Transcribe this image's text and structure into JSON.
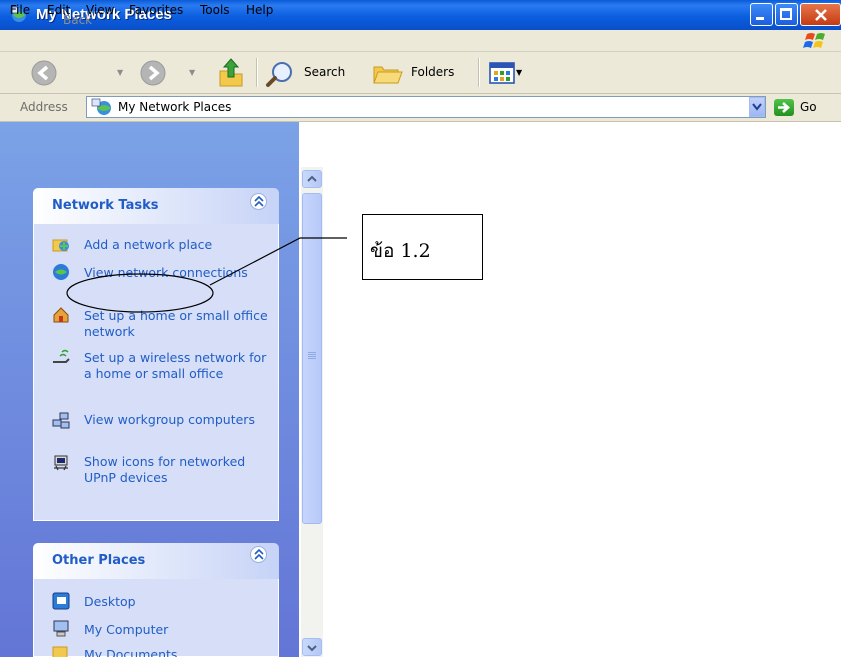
{
  "window": {
    "title": "My Network Places"
  },
  "menu": {
    "items": [
      "File",
      "Edit",
      "View",
      "Favorites",
      "Tools",
      "Help"
    ]
  },
  "toolbar": {
    "back_label": "Back",
    "search_label": "Search",
    "folders_label": "Folders"
  },
  "address": {
    "label": "Address",
    "value": "My Network Places",
    "go_label": "Go"
  },
  "network_tasks": {
    "title": "Network Tasks",
    "items": [
      {
        "label": "Add a network place",
        "icon": "add-network-place-icon"
      },
      {
        "label": "View network connections",
        "icon": "network-connections-icon"
      },
      {
        "label": "Set up a home or small office network",
        "icon": "home-network-icon"
      },
      {
        "label": "Set up a wireless network for a home or small office",
        "icon": "wireless-network-icon"
      },
      {
        "label": "View workgroup computers",
        "icon": "workgroup-icon"
      },
      {
        "label": "Show icons for networked UPnP devices",
        "icon": "upnp-devices-icon"
      }
    ]
  },
  "other_places": {
    "title": "Other Places",
    "items": [
      {
        "label": "Desktop",
        "icon": "desktop-icon"
      },
      {
        "label": "My Computer",
        "icon": "my-computer-icon"
      },
      {
        "label": "My Documents",
        "icon": "my-documents-icon"
      }
    ]
  },
  "annotation": {
    "text": "ข้อ 1.2"
  }
}
